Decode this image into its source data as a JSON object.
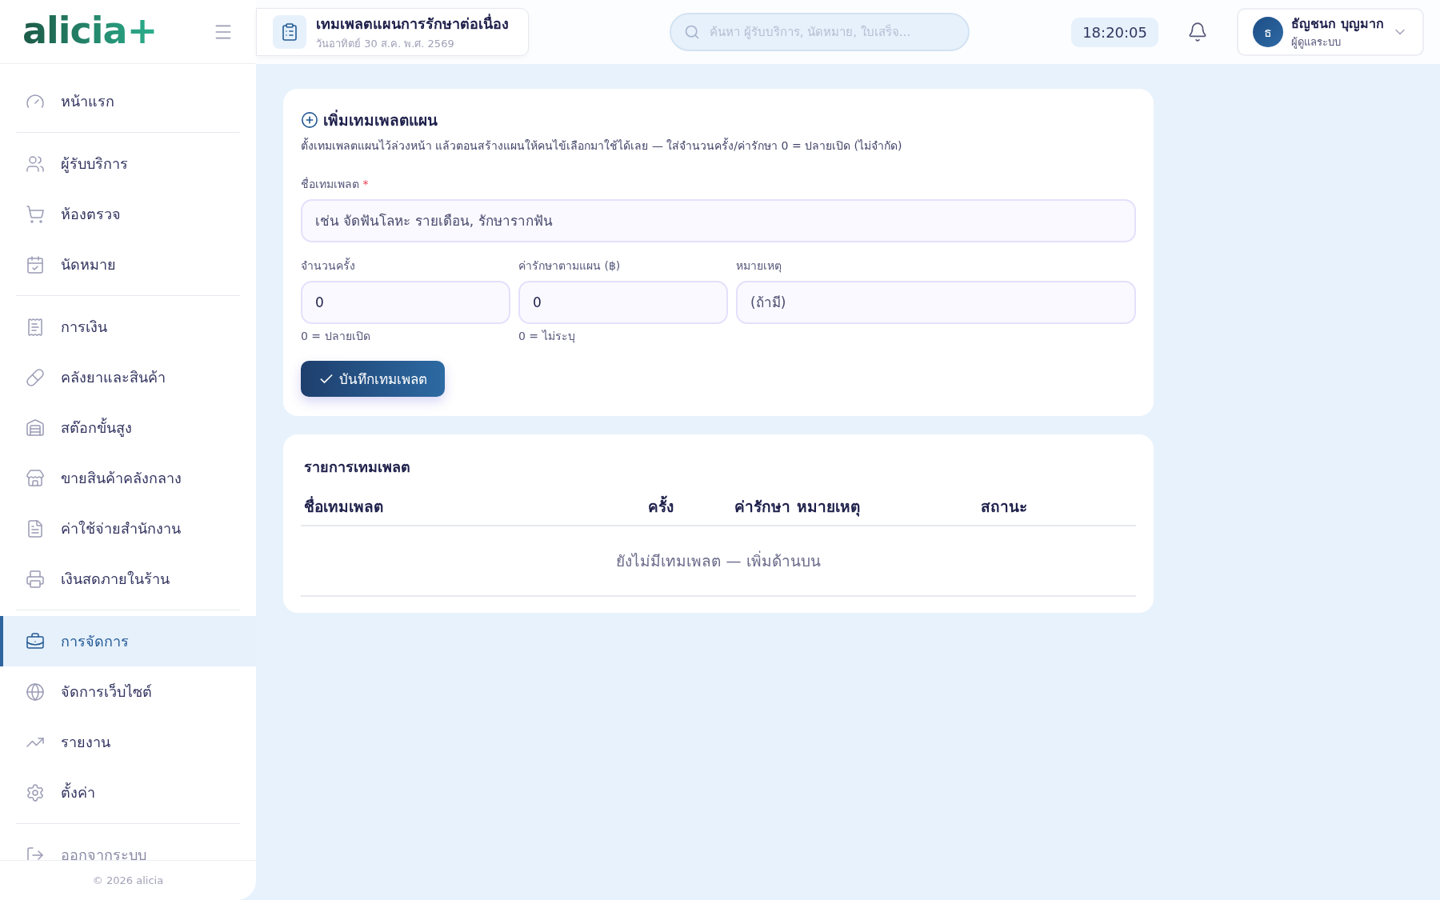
{
  "brand": {
    "name": "alicia",
    "mark": "+"
  },
  "header": {
    "page_title": "เทมเพลตแผนการรักษาต่อเนื่อง",
    "date": "วันอาทิตย์ 30 ส.ค. พ.ศ. 2569",
    "search": {
      "placeholder": "ค้นหา ผู้รับบริการ, นัดหมาย, ใบเสร็จ..."
    },
    "clock": "18:20:05",
    "user": {
      "initial": "ธ",
      "name": "ธัญชนก บุญมาก",
      "role": "ผู้ดูแลระบบ"
    }
  },
  "sidebar": {
    "groups": [
      [
        {
          "label": "หน้าแรก",
          "selected": false
        }
      ],
      [
        {
          "label": "ผู้รับบริการ",
          "selected": false
        },
        {
          "label": "ห้องตรวจ",
          "selected": false
        },
        {
          "label": "นัดหมาย",
          "selected": false
        }
      ],
      [
        {
          "label": "การเงิน",
          "selected": false
        },
        {
          "label": "คลังยาและสินค้า",
          "selected": false
        },
        {
          "label": "สต๊อกขั้นสูง",
          "selected": false
        },
        {
          "label": "ขายสินค้าคลังกลาง",
          "selected": false
        },
        {
          "label": "ค่าใช้จ่ายสำนักงาน",
          "selected": false
        },
        {
          "label": "เงินสดภายในร้าน",
          "selected": false
        }
      ],
      [
        {
          "label": "การจัดการ",
          "selected": true
        },
        {
          "label": "จัดการเว็บไซต์",
          "selected": false
        },
        {
          "label": "รายงาน",
          "selected": false
        },
        {
          "label": "ตั้งค่า",
          "selected": false
        }
      ],
      [
        {
          "label": "ออกจากระบบ",
          "selected": false
        }
      ]
    ],
    "footer": "© 2026 alicia"
  },
  "form": {
    "title": "เพิ่มเทมเพลตแผน",
    "description": "ตั้งเทมเพลตแผนไว้ล่วงหน้า แล้วตอนสร้างแผนให้คนไข้เลือกมาใช้ได้เลย — ใส่จำนวนครั้ง/ค่ารักษา 0 = ปลายเปิด (ไม่จำกัด)",
    "fields": [
      {
        "label": "ชื่อเทมเพลต",
        "required_mark": "*",
        "placeholder": "เช่น จัดฟันโลหะ รายเดือน, รักษารากฟัน"
      },
      {
        "label": "จำนวนครั้ง",
        "value": "0",
        "hint": "0 = ปลายเปิด"
      },
      {
        "label": "ค่ารักษาตามแผน (฿)",
        "value": "0",
        "hint": "0 = ไม่ระบุ"
      },
      {
        "label": "หมายเหตุ",
        "placeholder": "(ถ้ามี)"
      }
    ],
    "submit": "บันทึกเทมเพลต"
  },
  "table": {
    "title": "รายการเทมเพลต",
    "columns": [
      "ชื่อเทมเพลต",
      "ครั้ง",
      "ค่ารักษา",
      "หมายเหตุ",
      "สถานะ"
    ],
    "empty_message": "ยังไม่มีเทมเพลต — เพิ่มด้านบน"
  }
}
